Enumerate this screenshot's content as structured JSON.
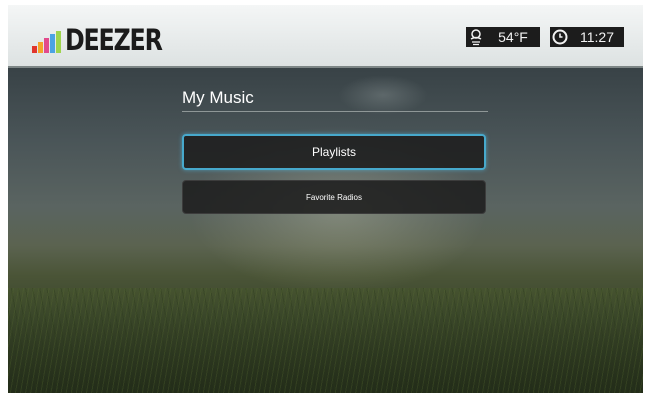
{
  "header": {
    "logo_text": "DEEZER",
    "logo_bar_colors": [
      "#e1362c",
      "#f4a52a",
      "#e24a8b",
      "#4ba3e3",
      "#9ed44d"
    ],
    "weather": {
      "icon": "weather-icon",
      "temperature": "54°F"
    },
    "clock": {
      "icon": "clock-icon",
      "time": "11:27"
    }
  },
  "main": {
    "title": "My Music",
    "menu": [
      {
        "label": "Playlists",
        "selected": true
      },
      {
        "label": "Favorite Radios",
        "selected": false
      }
    ]
  },
  "colors": {
    "focus_border": "#47a9cc",
    "button_bg": "#1e1e1e"
  }
}
